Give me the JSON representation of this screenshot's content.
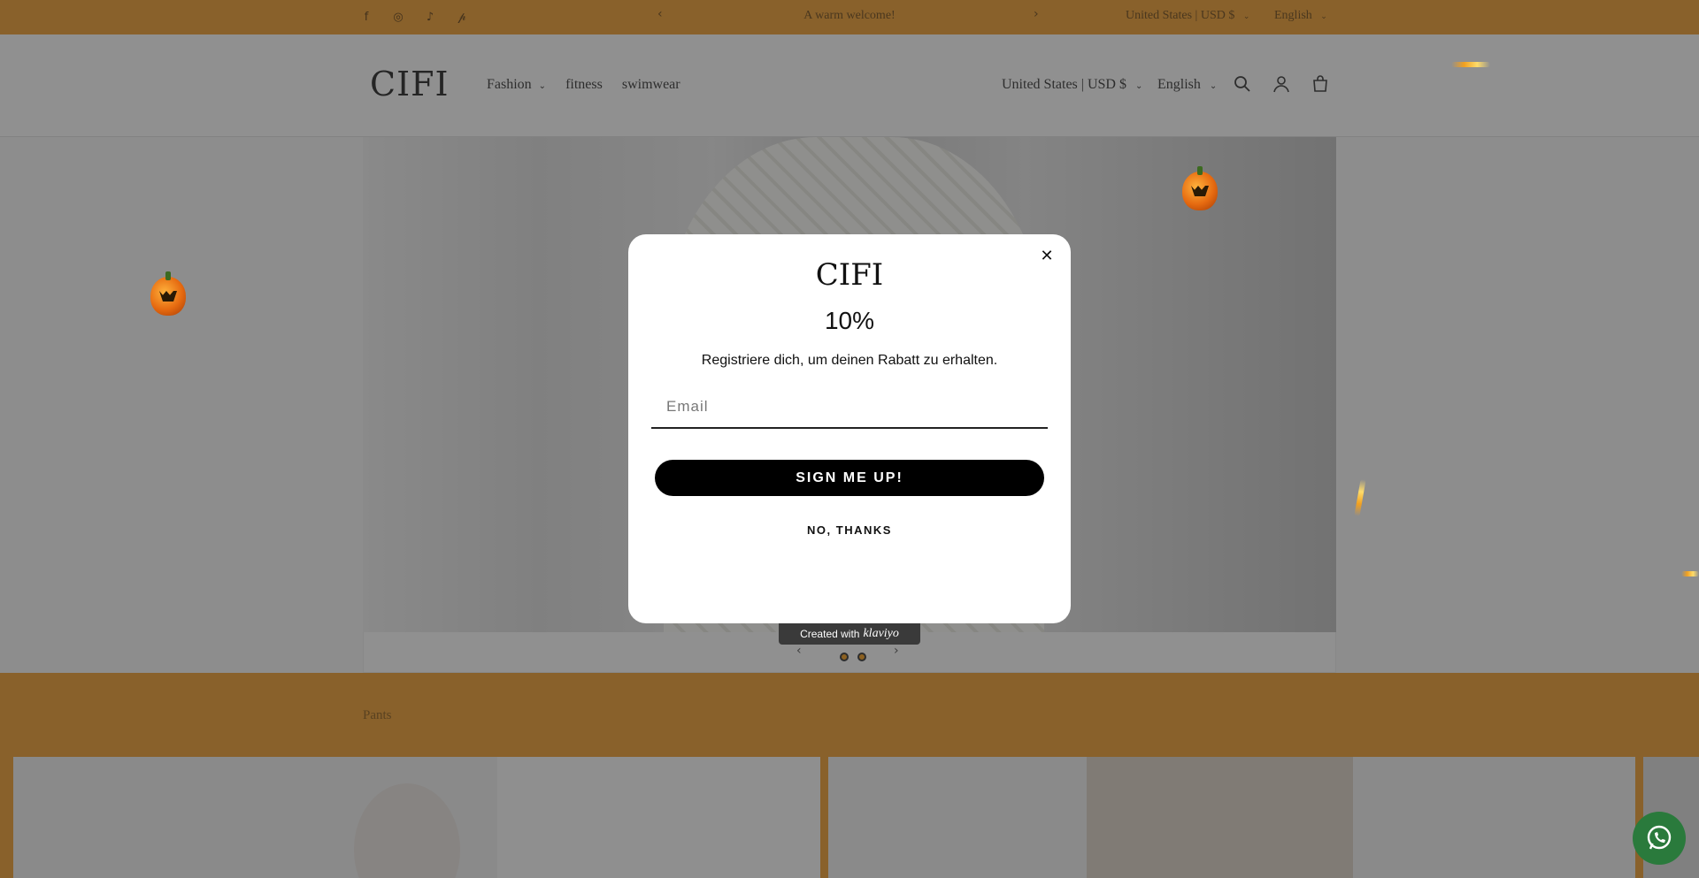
{
  "announcement": {
    "text": "A warm welcome!",
    "currency": "United States | USD $",
    "language": "English",
    "social": [
      "facebook-icon",
      "instagram-icon",
      "tiktok-icon",
      "pinterest-icon"
    ]
  },
  "header": {
    "logo": "CIFI",
    "nav": [
      {
        "label": "Fashion",
        "has_dropdown": true
      },
      {
        "label": "fitness",
        "has_dropdown": false
      },
      {
        "label": "swimwear",
        "has_dropdown": false
      }
    ],
    "currency": "United States | USD $",
    "language": "English",
    "icons": [
      "search-icon",
      "account-icon",
      "cart-icon"
    ]
  },
  "slideshow": {
    "slides": 2
  },
  "section": {
    "title": "Pants"
  },
  "modal": {
    "logo": "CIFI",
    "headline": "10%",
    "subtext": "Registriere dich, um deinen Rabatt zu erhalten.",
    "email_placeholder": "Email",
    "email_value": "",
    "signup_label": "SIGN ME UP!",
    "decline_label": "NO, THANKS",
    "close_symbol": "✕",
    "badge_prefix": "Created with",
    "badge_brand": "klaviyo"
  },
  "whatsapp": {
    "icon": "whatsapp-icon"
  },
  "colors": {
    "accent": "#ea9a2f",
    "button": "#000000",
    "overlay": "rgba(40,40,40,0.5)"
  }
}
